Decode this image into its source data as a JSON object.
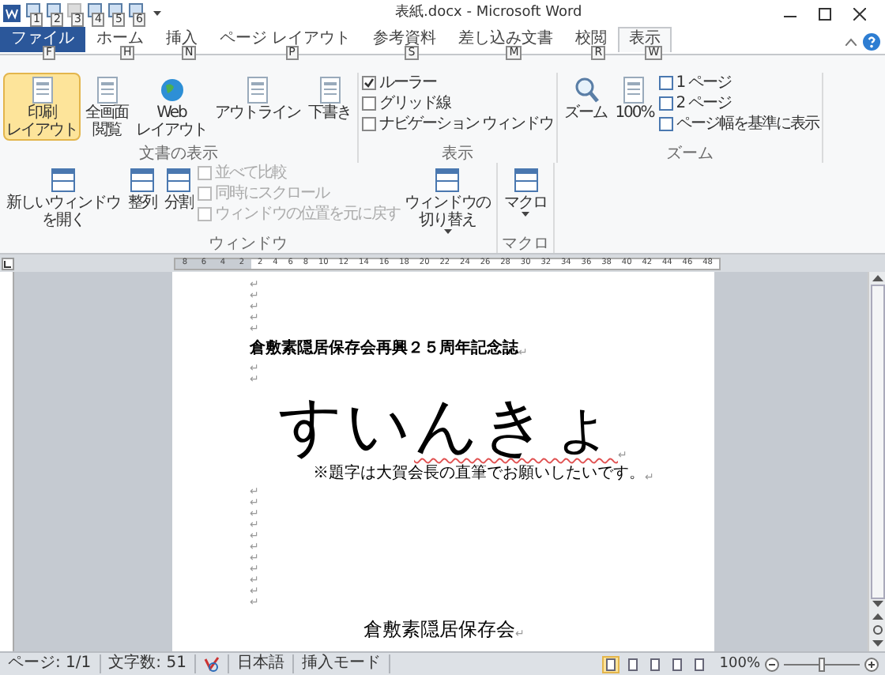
{
  "window": {
    "title": "表紙.docx - Microsoft Word"
  },
  "quick_access": [
    {
      "keytip": "1",
      "disabled": false
    },
    {
      "keytip": "2",
      "disabled": false
    },
    {
      "keytip": "3",
      "disabled": true
    },
    {
      "keytip": "4",
      "disabled": false
    },
    {
      "keytip": "5",
      "disabled": false
    },
    {
      "keytip": "6",
      "disabled": false
    }
  ],
  "tabs": [
    {
      "kind": "file",
      "label": "ファイル",
      "keytip": "F",
      "selected": false
    },
    {
      "kind": "tab",
      "label": "ホーム",
      "keytip": "H",
      "selected": false
    },
    {
      "kind": "tab",
      "label": "挿入",
      "keytip": "N",
      "selected": false
    },
    {
      "kind": "tab",
      "label": "ページ レイアウト",
      "keytip": "P",
      "selected": false
    },
    {
      "kind": "tab",
      "label": "参考資料",
      "keytip": "S",
      "selected": false
    },
    {
      "kind": "tab",
      "label": "差し込み文書",
      "keytip": "M",
      "selected": false
    },
    {
      "kind": "tab",
      "label": "校閲",
      "keytip": "R",
      "selected": false
    },
    {
      "kind": "tab",
      "label": "表示",
      "keytip": "W",
      "selected": true
    }
  ],
  "ribbon": {
    "groups": [
      {
        "label": "文書の表示",
        "columns": [
          {
            "kind": "large",
            "lines": [
              "印刷",
              "レイアウト"
            ],
            "selected": true
          },
          {
            "kind": "large",
            "lines": [
              "全画面",
              "閲覧"
            ],
            "selected": false
          },
          {
            "kind": "large",
            "lines": [
              "Web",
              "レイアウト"
            ],
            "selected": false
          },
          {
            "kind": "large",
            "lines": [
              "アウトライン"
            ],
            "selected": false
          },
          {
            "kind": "large",
            "lines": [
              "下書き"
            ],
            "selected": false
          }
        ]
      },
      {
        "label": "表示",
        "columns": [
          {
            "kind": "checks",
            "items": [
              {
                "label": "ルーラー",
                "checked": true
              },
              {
                "label": "グリッド線",
                "checked": false
              },
              {
                "label": "ナビゲーション ウィンドウ",
                "checked": false
              }
            ]
          }
        ]
      },
      {
        "label": "ズーム",
        "columns": [
          {
            "kind": "large",
            "lines": [
              "ズーム"
            ]
          },
          {
            "kind": "large",
            "lines": [
              "100%"
            ]
          },
          {
            "kind": "small",
            "items": [
              {
                "label": "1 ページ",
                "disabled": false
              },
              {
                "label": "2 ページ",
                "disabled": false
              },
              {
                "label": "ページ幅を基準に表示",
                "disabled": false
              }
            ]
          }
        ]
      },
      {
        "label": "ウィンドウ",
        "columns": [
          {
            "kind": "large",
            "lines": [
              "新しいウィンドウ",
              "を開く"
            ]
          },
          {
            "kind": "large",
            "lines": [
              "整列"
            ]
          },
          {
            "kind": "large",
            "lines": [
              "分割"
            ]
          },
          {
            "kind": "small",
            "items": [
              {
                "label": "並べて比較",
                "disabled": true
              },
              {
                "label": "同時にスクロール",
                "disabled": true
              },
              {
                "label": "ウィンドウの位置を元に戻す",
                "disabled": true
              }
            ]
          },
          {
            "kind": "large",
            "lines": [
              "ウィンドウの",
              "切り替え"
            ],
            "dropdown": true
          }
        ]
      },
      {
        "label": "マクロ",
        "columns": [
          {
            "kind": "large",
            "lines": [
              "マクロ"
            ],
            "dropdown": true
          }
        ]
      }
    ]
  },
  "ruler": {
    "left_numbers": [
      "8",
      "6",
      "4",
      "2"
    ],
    "numbers": [
      "2",
      "4",
      "6",
      "8",
      "10",
      "12",
      "14",
      "16",
      "18",
      "20",
      "22",
      "24",
      "26",
      "28",
      "30",
      "32",
      "34",
      "36",
      "38",
      "40",
      "42",
      "44",
      "46",
      "48"
    ]
  },
  "document": {
    "paragraphs": [
      {
        "kind": "empty",
        "mark": "↵"
      },
      {
        "kind": "empty",
        "mark": "↵"
      },
      {
        "kind": "empty",
        "mark": "↵"
      },
      {
        "kind": "empty",
        "mark": "↵"
      },
      {
        "kind": "empty",
        "mark": "↵"
      },
      {
        "kind": "heading",
        "text": "倉敷素隠居保存会再興２５周年記念誌",
        "mark": "↵"
      },
      {
        "kind": "empty",
        "mark": "↵"
      },
      {
        "kind": "empty",
        "mark": "↵"
      },
      {
        "kind": "title",
        "segments": [
          {
            "text": "すい",
            "flagged": false
          },
          {
            "text": "んきょ",
            "flagged": true
          }
        ],
        "mark": "↵"
      },
      {
        "kind": "note",
        "text": "※題字は大賀会長の直筆でお願いしたいです。",
        "mark": "↵"
      },
      {
        "kind": "empty",
        "mark": "↵"
      },
      {
        "kind": "empty",
        "mark": "↵"
      },
      {
        "kind": "empty",
        "mark": "↵"
      },
      {
        "kind": "empty",
        "mark": "↵"
      },
      {
        "kind": "empty",
        "mark": "↵"
      },
      {
        "kind": "empty",
        "mark": "↵"
      },
      {
        "kind": "empty",
        "mark": "↵"
      },
      {
        "kind": "empty",
        "mark": "↵"
      },
      {
        "kind": "empty",
        "mark": "↵"
      },
      {
        "kind": "empty",
        "mark": "↵"
      },
      {
        "kind": "empty",
        "mark": "↵"
      },
      {
        "kind": "footer",
        "text": "倉敷素隠居保存会",
        "mark": "↵"
      }
    ]
  },
  "status_bar": {
    "items": [
      {
        "kind": "text",
        "text": "ページ: 1/1"
      },
      {
        "kind": "text",
        "text": "文字数: 51"
      },
      {
        "kind": "proofing"
      },
      {
        "kind": "text",
        "text": "日本語"
      },
      {
        "kind": "text",
        "text": "挿入モード"
      }
    ],
    "views": [
      {
        "selected": true
      },
      {
        "selected": false
      },
      {
        "selected": false
      },
      {
        "selected": false
      },
      {
        "selected": false
      }
    ],
    "zoom": {
      "reading": "100%",
      "level": 0.5
    }
  }
}
